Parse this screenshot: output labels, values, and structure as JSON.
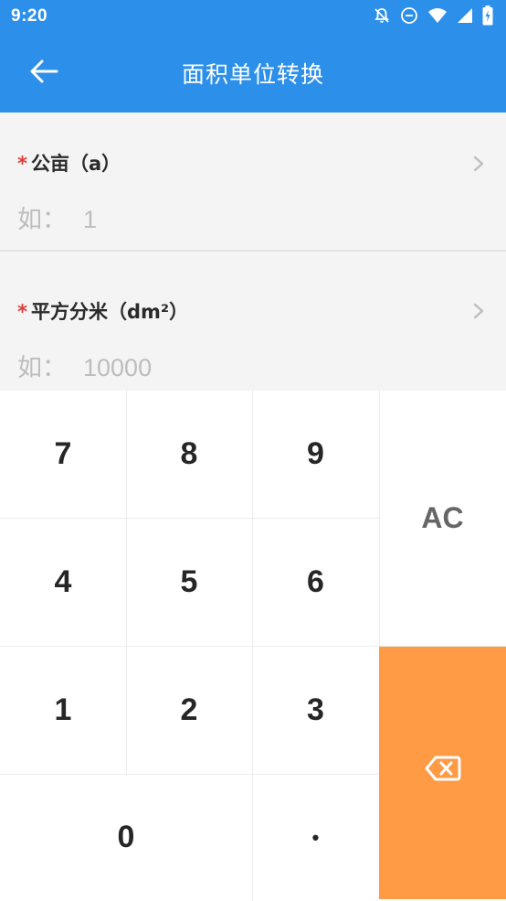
{
  "status_bar": {
    "time": "9:20",
    "icons": [
      "notifications-off-icon",
      "do-not-disturb-icon",
      "wifi-icon",
      "signal-icon",
      "battery-charging-icon"
    ]
  },
  "app_bar": {
    "title": "面积单位转换",
    "back_icon": "arrow-left-icon"
  },
  "fields": [
    {
      "required_mark": "*",
      "label": "公亩（a）",
      "prefix": "如：",
      "placeholder": "1"
    },
    {
      "required_mark": "*",
      "label": "平方分米（dm²）",
      "prefix": "如：",
      "placeholder": "10000"
    }
  ],
  "keypad": {
    "keys": {
      "k7": "7",
      "k8": "8",
      "k9": "9",
      "k4": "4",
      "k5": "5",
      "k6": "6",
      "k1": "1",
      "k2": "2",
      "k3": "3",
      "k0": "0",
      "dot": "•",
      "clear": "AC"
    },
    "delete_icon": "backspace-icon",
    "accent_color": "#ff9a45"
  },
  "colors": {
    "primary": "#2c8fe9",
    "required": "#e53935"
  }
}
